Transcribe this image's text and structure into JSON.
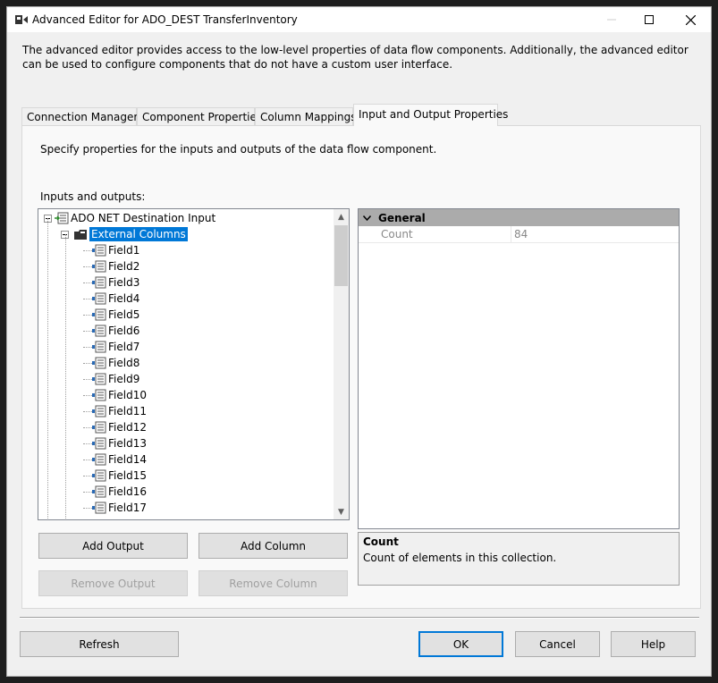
{
  "window": {
    "title": "Advanced Editor for ADO_DEST TransferInventory",
    "description": "The advanced editor provides access to the low-level properties of data flow components. Additionally, the advanced editor can be used to configure components that do not have a custom user interface."
  },
  "tabs": [
    {
      "label": "Connection Managers",
      "active": false
    },
    {
      "label": "Component Properties",
      "active": false
    },
    {
      "label": "Column Mappings",
      "active": false
    },
    {
      "label": "Input and Output Properties",
      "active": true
    }
  ],
  "panel": {
    "description": "Specify properties for the inputs and outputs of the data flow component.",
    "io_label": "Inputs and outputs:"
  },
  "tree": {
    "root": "ADO NET Destination Input",
    "group": "External Columns",
    "fields": [
      "Field1",
      "Field2",
      "Field3",
      "Field4",
      "Field5",
      "Field6",
      "Field7",
      "Field8",
      "Field9",
      "Field10",
      "Field11",
      "Field12",
      "Field13",
      "Field14",
      "Field15",
      "Field16",
      "Field17"
    ]
  },
  "properties": {
    "category": "General",
    "rows": [
      {
        "name": "Count",
        "value": "84"
      }
    ]
  },
  "help": {
    "title": "Count",
    "text": "Count of elements in this collection."
  },
  "buttons": {
    "add_output": "Add Output",
    "add_column": "Add Column",
    "remove_output": "Remove Output",
    "remove_column": "Remove Column",
    "refresh": "Refresh",
    "ok": "OK",
    "cancel": "Cancel",
    "help": "Help"
  },
  "colors": {
    "selection": "#0078d7",
    "category_bg": "#ababab"
  }
}
